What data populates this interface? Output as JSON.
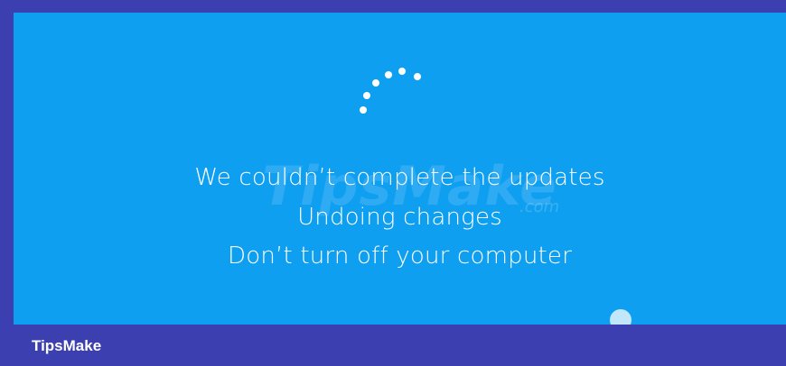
{
  "screen": {
    "messages": [
      "We couldn’t complete the updates",
      "Undoing changes",
      "Don’t turn off your computer"
    ]
  },
  "watermark": {
    "text": "TipsMake",
    "suffix": ".com"
  },
  "footer": {
    "brand": "TipsMake"
  },
  "icons": {
    "spinner": "loading-spinner-icon"
  },
  "colors": {
    "screen_bg": "#0f9ff0",
    "frame_bg": "#3b3fb0",
    "text": "#ffffff"
  }
}
